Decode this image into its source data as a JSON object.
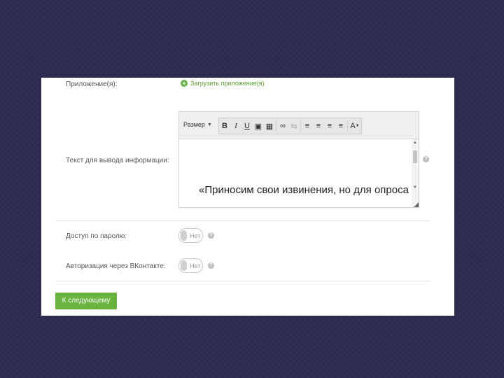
{
  "form": {
    "attachments_label": "Приложение(я):",
    "upload_link_label": "Загрузить приложение(я)",
    "info_text_label": "Текст для вывода информации:",
    "editor": {
      "size_select_label": "Размер",
      "toolbar": {
        "bold": "B",
        "italic": "I",
        "underline": "U",
        "image": "▣",
        "table": "▦",
        "link": "∞",
        "unlink": "⇆",
        "align_left": "≡",
        "align_center": "≡",
        "align_right": "≡",
        "justify": "≡",
        "font_color": "A"
      },
      "content": "«Приносим свои извинения, но для опроса"
    },
    "password_access_label": "Доступ по паролю:",
    "vk_auth_label": "Авторизация через ВКонтакте:",
    "toggle_off_label": "Нет",
    "help_symbol": "?",
    "next_button_label": "К следующему шагу"
  },
  "colors": {
    "background": "#2b2a4f",
    "accent_green": "#69b33f",
    "panel": "#ffffff"
  }
}
